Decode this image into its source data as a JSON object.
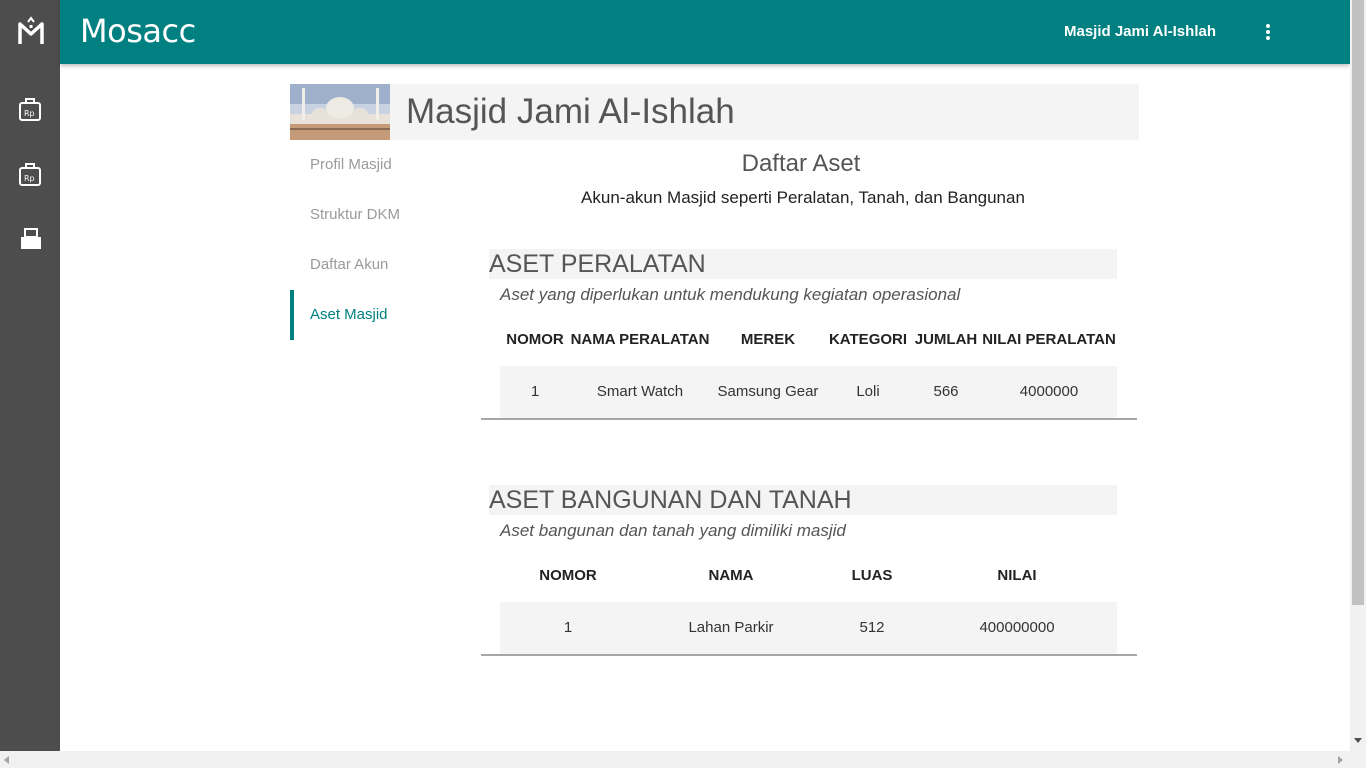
{
  "app": {
    "brand": "Mosacc",
    "org_name": "Masjid Jami Al-Ishlah"
  },
  "rail": {
    "icons": [
      "mosacc-logo-icon",
      "report-icon",
      "report-icon",
      "print-icon"
    ]
  },
  "mosque": {
    "name": "Masjid Jami Al-Ishlah"
  },
  "sidemenu": {
    "items": [
      {
        "label": "Profil Masjid"
      },
      {
        "label": "Struktur DKM"
      },
      {
        "label": "Daftar Akun"
      },
      {
        "label": "Aset Masjid",
        "active": true
      }
    ]
  },
  "main": {
    "title": "Daftar Aset",
    "subtitle": "Akun-akun Masjid seperti Peralatan, Tanah, dan Bangunan"
  },
  "equipment": {
    "heading": "ASET PERALATAN",
    "description": "Aset yang diperlukan untuk mendukung kegiatan operasional",
    "columns": [
      "NOMOR",
      "NAMA PERALATAN",
      "MEREK",
      "KATEGORI",
      "JUMLAH",
      "NILAI PERALATAN"
    ],
    "rows": [
      [
        "1",
        "Smart Watch",
        "Samsung Gear",
        "Loli",
        "566",
        "4000000"
      ]
    ]
  },
  "property": {
    "heading": "ASET BANGUNAN DAN TANAH",
    "description": "Aset bangunan dan tanah yang dimiliki masjid",
    "columns": [
      "NOMOR",
      "NAMA",
      "LUAS",
      "NILAI"
    ],
    "rows": [
      [
        "1",
        "Lahan Parkir",
        "512",
        "400000000"
      ]
    ]
  },
  "colors": {
    "accent": "#008080",
    "rail": "#4d4d4d",
    "panel": "#f4f4f4"
  }
}
